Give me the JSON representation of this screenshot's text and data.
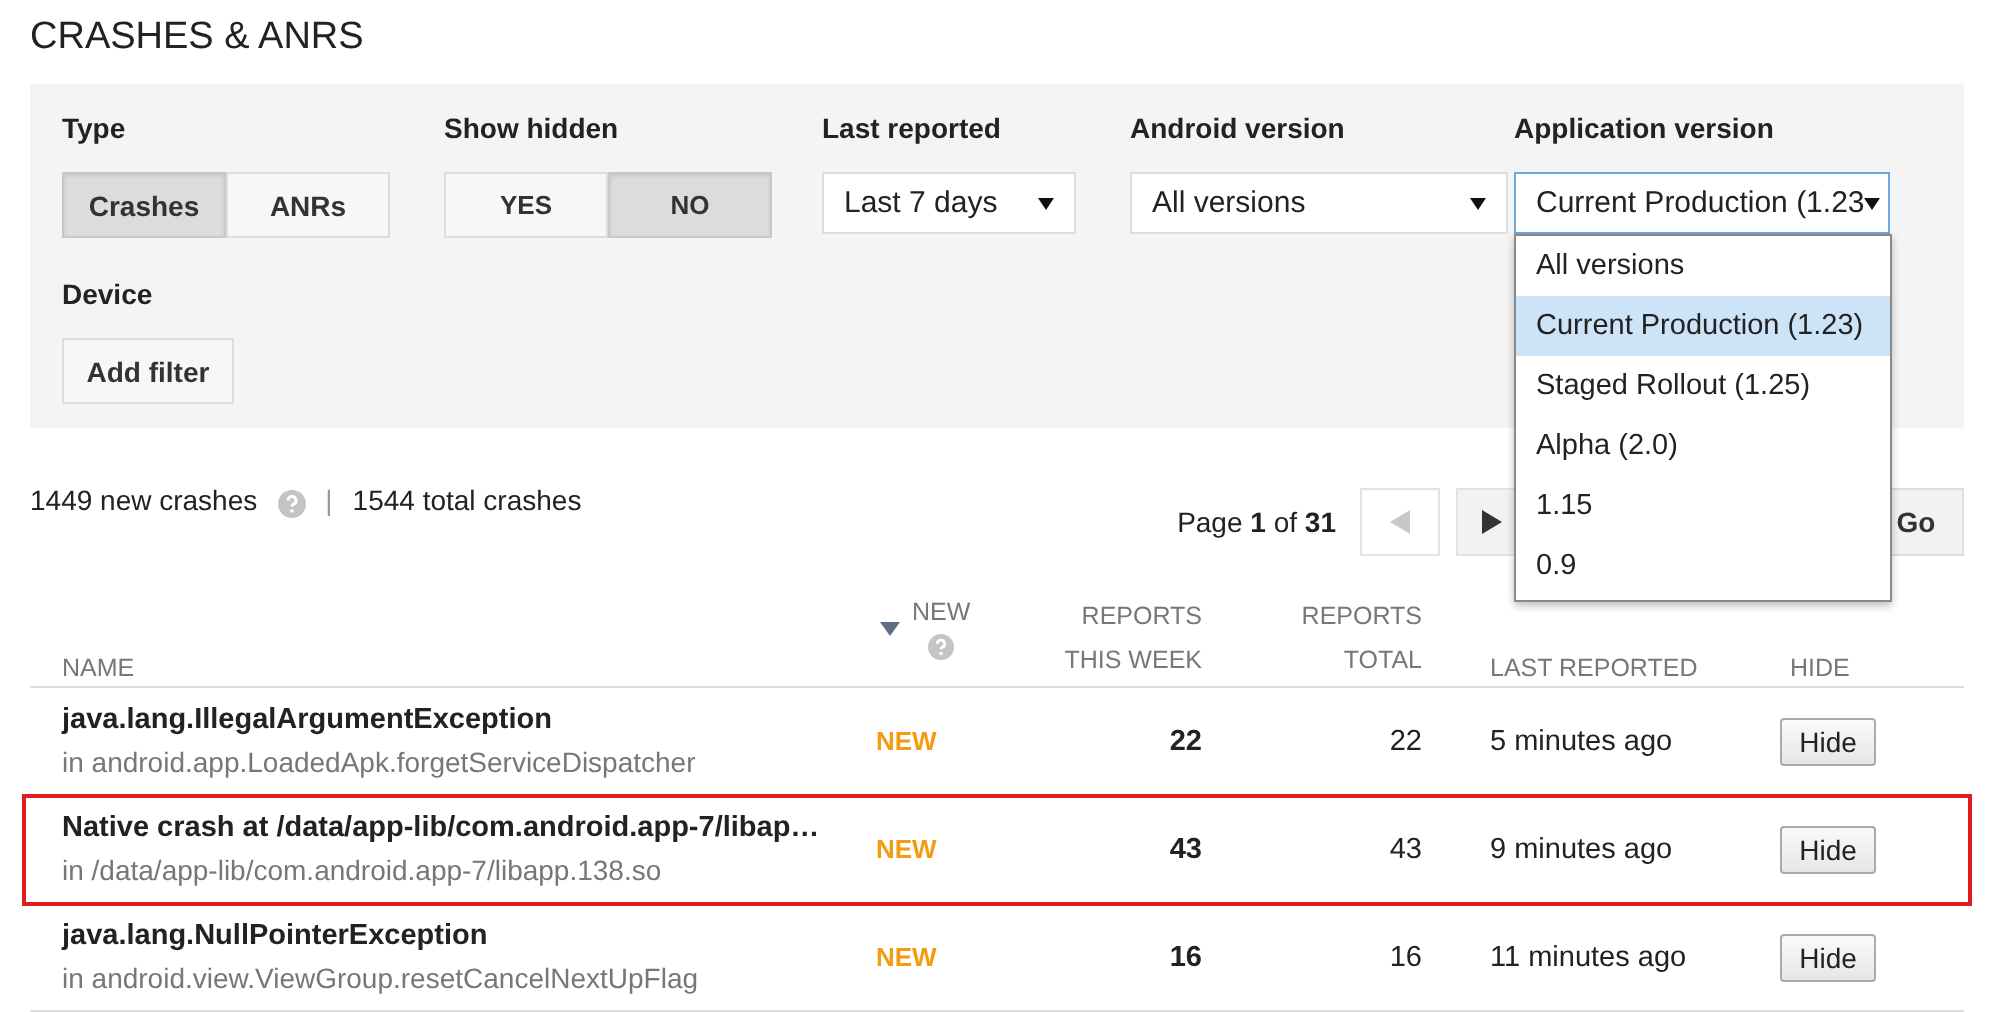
{
  "title": "CRASHES & ANRS",
  "filters": {
    "type": {
      "label": "Type",
      "options": [
        {
          "label": "Crashes",
          "selected": true
        },
        {
          "label": "ANRs",
          "selected": false
        }
      ]
    },
    "show_hidden": {
      "label": "Show hidden",
      "options": [
        {
          "label": "YES",
          "selected": false
        },
        {
          "label": "NO",
          "selected": true
        }
      ]
    },
    "last_reported": {
      "label": "Last reported",
      "value": "Last 7 days"
    },
    "android_version": {
      "label": "Android version",
      "value": "All versions"
    },
    "app_version": {
      "label": "Application version",
      "value": "Current Production (1.23",
      "expanded": true,
      "options": [
        {
          "label": "All versions",
          "selected": false
        },
        {
          "label": "Current Production (1.23)",
          "selected": true
        },
        {
          "label": "Staged Rollout (1.25)",
          "selected": false
        },
        {
          "label": "Alpha (2.0)",
          "selected": false
        },
        {
          "label": "1.15",
          "selected": false
        },
        {
          "label": "0.9",
          "selected": false
        }
      ]
    },
    "device": {
      "label": "Device",
      "button": "Add filter"
    }
  },
  "summary": {
    "new_crashes": "1449 new crashes",
    "separator": "|",
    "total_crashes": "1544 total crashes"
  },
  "pagination": {
    "page_label": "Page **1** of **31**",
    "go": "Go"
  },
  "table": {
    "columns": [
      {
        "label": "NAME",
        "sorted": false
      },
      {
        "label": "NEW",
        "sorted": true
      },
      {
        "label": "REPORTS THIS WEEK",
        "sorted": false
      },
      {
        "label": "REPORTS TOTAL",
        "sorted": false
      },
      {
        "label": "LAST REPORTED",
        "sorted": false
      },
      {
        "label": "HIDE",
        "sorted": false
      }
    ],
    "rows": [
      {
        "name": "java.lang.IllegalArgumentException",
        "location": "in android.app.LoadedApk.forgetServiceDispatcher",
        "new": "NEW",
        "this_week": "22",
        "total": "22",
        "last_reported": "5 minutes ago",
        "hide": "Hide",
        "highlighted": false
      },
      {
        "name": "Native crash at /data/app-lib/com.android.app-7/libap…",
        "location": "in /data/app-lib/com.android.app-7/libapp.138.so",
        "new": "NEW",
        "this_week": "43",
        "total": "43",
        "last_reported": "9 minutes ago",
        "hide": "Hide",
        "highlighted": true
      },
      {
        "name": "java.lang.NullPointerException",
        "location": "in android.view.ViewGroup.resetCancelNextUpFlag",
        "new": "NEW",
        "this_week": "16",
        "total": "16",
        "last_reported": "11 minutes ago",
        "hide": "Hide",
        "highlighted": false
      }
    ]
  }
}
